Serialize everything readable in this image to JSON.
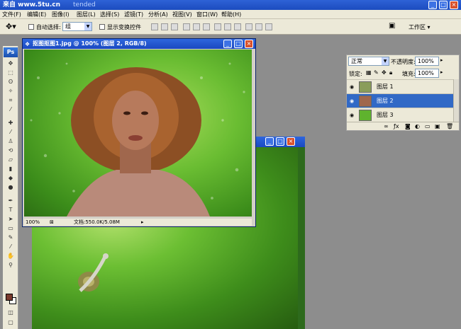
{
  "window": {
    "watermark": "来自 www.5tu.cn",
    "title_suffix": "tended"
  },
  "menu": [
    "文件(F)",
    "编辑(E)",
    "图像(I)",
    "图层(L)",
    "选择(S)",
    "滤镜(T)",
    "分析(A)",
    "视图(V)",
    "窗口(W)",
    "帮助(H)"
  ],
  "options": {
    "auto_select_label": "自动选择:",
    "auto_select_value": "组",
    "transform_label": "显示变换控件",
    "workspace_label": "工作区 ▾"
  },
  "doc1": {
    "title": "抠图抠图1.jpg @ 100% (图层 2, RGB/8)",
    "zoom": "100%",
    "doc_info": "文档:550.0K/5.08M"
  },
  "layers_panel": {
    "blend_mode": "正常",
    "opacity_label": "不透明度:",
    "opacity_value": "100%",
    "lock_label": "锁定:",
    "fill_label": "填充:",
    "fill_value": "100%",
    "layers": [
      "图层 1",
      "图层 2",
      "图层 3"
    ]
  },
  "toolbox": {
    "logo": "Ps"
  },
  "colors": {
    "foreground": "#7a3b2e",
    "background": "#ffffff",
    "titlebar": "#2056cd"
  }
}
